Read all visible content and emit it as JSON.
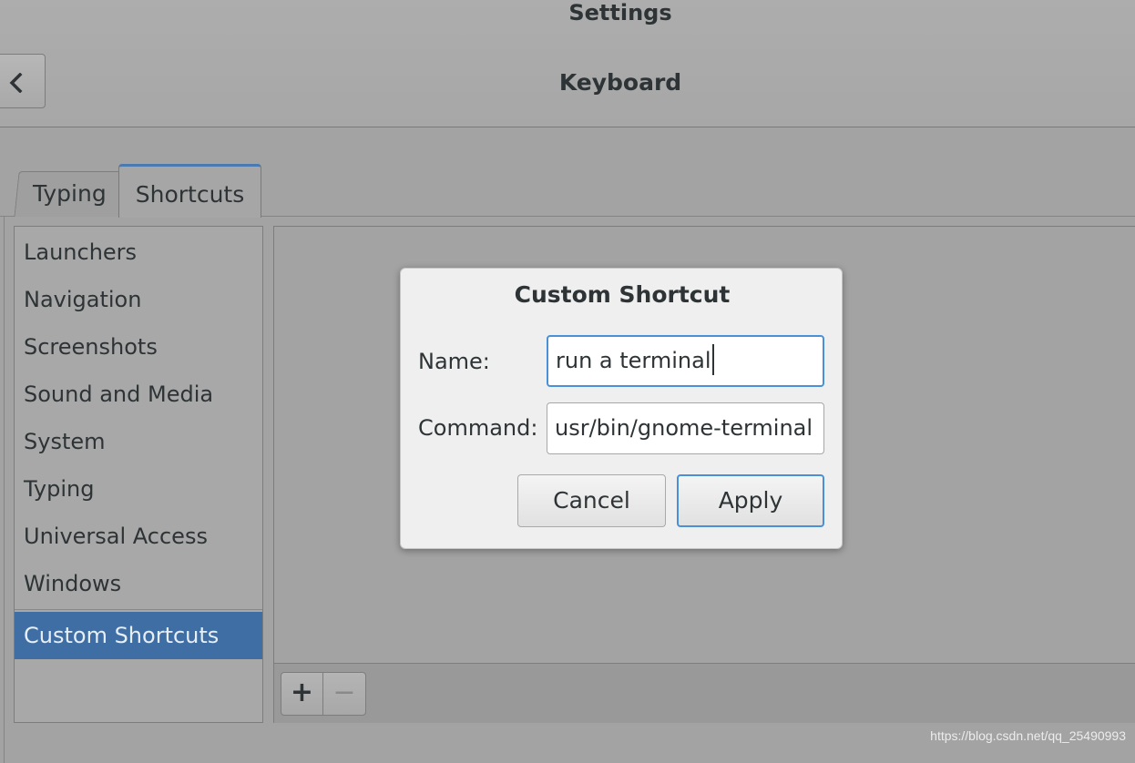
{
  "header": {
    "app_title": "Settings",
    "page_title": "Keyboard",
    "back_icon": "chevron-left-icon"
  },
  "tabs": [
    {
      "label": "Typing",
      "selected": false
    },
    {
      "label": "Shortcuts",
      "selected": true
    }
  ],
  "sidebar": {
    "items": [
      {
        "label": "Launchers"
      },
      {
        "label": "Navigation"
      },
      {
        "label": "Screenshots"
      },
      {
        "label": "Sound and Media"
      },
      {
        "label": "System"
      },
      {
        "label": "Typing"
      },
      {
        "label": "Universal Access"
      },
      {
        "label": "Windows"
      },
      {
        "label": "Custom Shortcuts",
        "selected": true
      }
    ]
  },
  "toolbar": {
    "add_label": "+",
    "remove_label": "−"
  },
  "dialog": {
    "title": "Custom Shortcut",
    "name_label": "Name:",
    "name_value": "run a terminal",
    "command_label": "Command:",
    "command_value": "usr/bin/gnome-terminal",
    "cancel_label": "Cancel",
    "apply_label": "Apply"
  },
  "colors": {
    "selection": "#3e6ea3",
    "focus": "#4a90d9",
    "background": "#a3a3a3"
  },
  "watermark": "https://blog.csdn.net/qq_25490993"
}
